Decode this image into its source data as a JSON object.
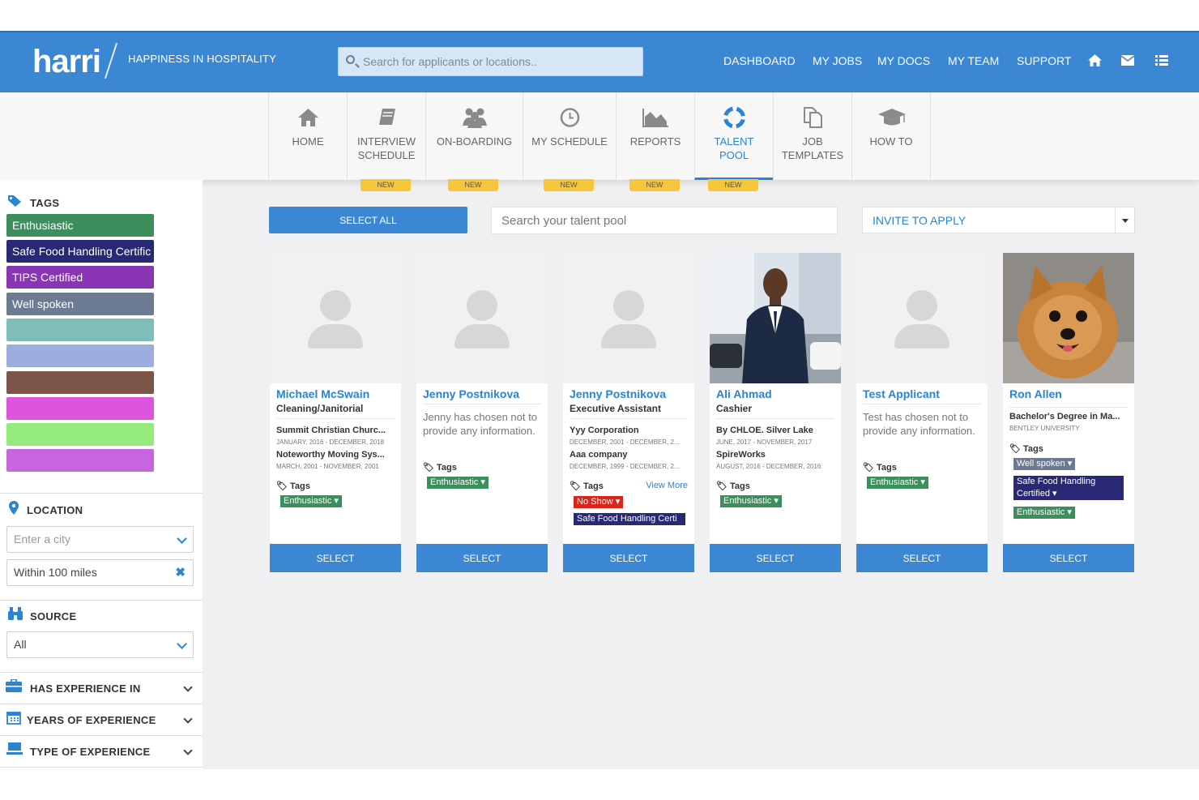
{
  "header": {
    "logo": "harri",
    "tagline": "HAPPINESS IN HOSPITALITY",
    "search_placeholder": "Search for applicants or locations..",
    "nav": [
      "DASHBOARD",
      "MY JOBS",
      "MY DOCS",
      "MY TEAM",
      "SUPPORT"
    ],
    "icons": [
      "home-icon",
      "envelope-icon",
      "list-icon"
    ]
  },
  "subnav": {
    "items": [
      {
        "label": "HOME",
        "icon": "home-icon",
        "new": false,
        "active": false
      },
      {
        "label": "INTERVIEW\nSCHEDULE",
        "icon": "book-icon",
        "new": true,
        "active": false
      },
      {
        "label": "ON-BOARDING",
        "icon": "users-icon",
        "new": true,
        "active": false
      },
      {
        "label": "MY SCHEDULE",
        "icon": "clock-icon",
        "new": true,
        "active": false
      },
      {
        "label": "REPORTS",
        "icon": "area-chart-icon",
        "new": true,
        "active": false
      },
      {
        "label": "TALENT\nPOOL",
        "icon": "lifebuoy-icon",
        "new": true,
        "active": true
      },
      {
        "label": "JOB\nTEMPLATES",
        "icon": "copy-icon",
        "new": false,
        "active": false
      },
      {
        "label": "HOW TO",
        "icon": "graduation-cap-icon",
        "new": false,
        "active": false
      }
    ],
    "new_badge": "NEW"
  },
  "sidebar": {
    "tags_title": "TAGS",
    "tags": [
      {
        "label": "Enthusiastic",
        "color": "#3c8f5c"
      },
      {
        "label": "Safe Food Handling Certific",
        "color": "#282874"
      },
      {
        "label": "TIPS Certified",
        "color": "#8a35b3"
      },
      {
        "label": "Well spoken",
        "color": "#6c7a92"
      },
      {
        "label": "",
        "color": "#7fbdb8"
      },
      {
        "label": "",
        "color": "#9cadde"
      },
      {
        "label": "",
        "color": "#7d5448"
      },
      {
        "label": "",
        "color": "#dc55dc"
      },
      {
        "label": "",
        "color": "#94ea7a"
      },
      {
        "label": "",
        "color": "#c866e0"
      }
    ],
    "location_title": "LOCATION",
    "city_placeholder": "Enter a city",
    "radius": "Within 100 miles",
    "source_title": "SOURCE",
    "source_value": "All",
    "collapsibles": [
      "HAS EXPERIENCE IN",
      "YEARS OF EXPERIENCE",
      "TYPE OF EXPERIENCE"
    ]
  },
  "toolbar": {
    "select_all": "SELECT ALL",
    "search_placeholder": "Search your talent pool",
    "invite": "INVITE TO APPLY"
  },
  "cards": [
    {
      "name": "Michael McSwain",
      "role": "Cleaning/Janitorial",
      "photo": "placeholder",
      "experience": [
        {
          "employer": "Summit Christian Churc...",
          "dates": "JANUARY, 2016 - DECEMBER, 2018"
        },
        {
          "employer": "Noteworthy Moving Sys...",
          "dates": "MARCH, 2001 - NOVEMBER, 2001"
        }
      ],
      "tags_label": "Tags",
      "tags": [
        {
          "label": "Enthusiastic ▾",
          "color": "#3c8f5c"
        }
      ],
      "select": "SELECT"
    },
    {
      "name": "Jenny Postnikova",
      "photo": "placeholder",
      "note": "Jenny has chosen not to provide any information.",
      "tags_label": "Tags",
      "tags": [
        {
          "label": "Enthusiastic ▾",
          "color": "#3c8f5c"
        }
      ],
      "select": "SELECT"
    },
    {
      "name": "Jenny Postnikova",
      "role": "Executive Assistant",
      "photo": "placeholder",
      "experience": [
        {
          "employer": "Yyy Corporation",
          "dates": "DECEMBER, 2001 - DECEMBER, 2..."
        },
        {
          "employer": "Aaa company",
          "dates": "DECEMBER, 1999 - DECEMBER, 2..."
        }
      ],
      "tags_label": "Tags",
      "view_more": "View More",
      "tags": [
        {
          "label": "No Show ▾",
          "color": "#d9261c"
        },
        {
          "label": "Safe Food Handling Certi",
          "color": "#282874"
        }
      ],
      "select": "SELECT"
    },
    {
      "name": "Ali Ahmad",
      "role": "Cashier",
      "photo": "man-photo",
      "experience": [
        {
          "employer": "By CHLOE. Silver Lake",
          "dates": "JUNE, 2017 - NOVEMBER, 2017"
        },
        {
          "employer": "SpireWorks",
          "dates": "AUGUST, 2016 - DECEMBER, 2016"
        }
      ],
      "tags_label": "Tags",
      "tags": [
        {
          "label": "Enthusiastic ▾",
          "color": "#3c8f5c"
        }
      ],
      "select": "SELECT"
    },
    {
      "name": "Test Applicant",
      "photo": "placeholder",
      "note": "Test has chosen not to provide any information.",
      "tags_label": "Tags",
      "tags": [
        {
          "label": "Enthusiastic ▾",
          "color": "#3c8f5c"
        }
      ],
      "select": "SELECT"
    },
    {
      "name": "Ron Allen",
      "role": "Bachelor's Degree in Ma...",
      "school": "BENTLEY UNIVERSITY",
      "photo": "dog-photo",
      "tags_label": "Tags",
      "tags": [
        {
          "label": "Well spoken ▾",
          "color": "#6c7a92"
        },
        {
          "label": "Safe Food Handling Certified ▾",
          "color": "#282874"
        },
        {
          "label": "Enthusiastic ▾",
          "color": "#3c8f5c"
        }
      ],
      "select": "SELECT"
    }
  ]
}
